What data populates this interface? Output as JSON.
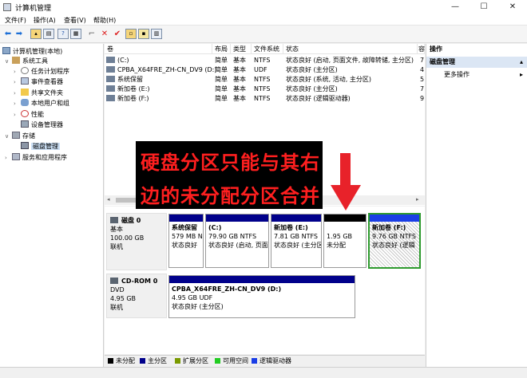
{
  "window": {
    "title": "计算机管理",
    "min": "—",
    "max": "☐",
    "close": "✕"
  },
  "menu": [
    "文件(F)",
    "操作(A)",
    "查看(V)",
    "帮助(H)"
  ],
  "toolbar_icons": [
    "back-icon",
    "forward-icon",
    "up-folder-icon",
    "show-tree-icon",
    "help-icon",
    "properties-icon",
    "connect-icon",
    "delete-icon",
    "check-icon",
    "open-icon",
    "new-window-icon",
    "refresh-icon"
  ],
  "tree": {
    "root": "计算机管理(本地)",
    "system_tools": "系统工具",
    "task_scheduler": "任务计划程序",
    "event_viewer": "事件查看器",
    "shared_folders": "共享文件夹",
    "local_users": "本地用户和组",
    "performance": "性能",
    "device_manager": "设备管理器",
    "storage": "存储",
    "disk_management": "磁盘管理",
    "services": "服务和应用程序"
  },
  "volume_table": {
    "headers": [
      "卷",
      "布局",
      "类型",
      "文件系统",
      "状态",
      "容"
    ],
    "rows": [
      {
        "vol": "(C:)",
        "layout": "简单",
        "type": "基本",
        "fs": "NTFS",
        "status": "状态良好 (启动, 页面文件, 故障转储, 主分区)",
        "cap": "7"
      },
      {
        "vol": "CPBA_X64FRE_ZH-CN_DV9 (D:)",
        "layout": "简单",
        "type": "基本",
        "fs": "UDF",
        "status": "状态良好 (主分区)",
        "cap": "4"
      },
      {
        "vol": "系统保留",
        "layout": "简单",
        "type": "基本",
        "fs": "NTFS",
        "status": "状态良好 (系统, 活动, 主分区)",
        "cap": "5"
      },
      {
        "vol": "新加卷 (E:)",
        "layout": "简单",
        "type": "基本",
        "fs": "NTFS",
        "status": "状态良好 (主分区)",
        "cap": "7"
      },
      {
        "vol": "新加卷 (F:)",
        "layout": "简单",
        "type": "基本",
        "fs": "NTFS",
        "status": "状态良好 (逻辑驱动器)",
        "cap": "9"
      }
    ]
  },
  "disk0": {
    "name": "磁盘 0",
    "kind": "基本",
    "size": "100.00 GB",
    "state": "联机",
    "parts": [
      {
        "title": "系统保留",
        "size": "579 MB N",
        "status": "状态良好"
      },
      {
        "title": "(C:)",
        "size": "79.90 GB NTFS",
        "status": "状态良好 (启动, 页面"
      },
      {
        "title": "新加卷 (E:)",
        "size": "7.81 GB NTFS",
        "status": "状态良好 (主分区)"
      },
      {
        "title": "",
        "size": "1.95 GB",
        "status": "未分配"
      },
      {
        "title": "新加卷 (F:)",
        "size": "9.76 GB NTFS",
        "status": "状态良好 (逻辑"
      }
    ]
  },
  "cdrom0": {
    "name": "CD-ROM 0",
    "kind": "DVD",
    "size": "4.95 GB",
    "state": "联机",
    "part": {
      "title": "CPBA_X64FRE_ZH-CN_DV9 (D:)",
      "size": "4.95 GB UDF",
      "status": "状态良好 (主分区)"
    }
  },
  "legend": [
    {
      "label": "未分配",
      "color": "#000000"
    },
    {
      "label": "主分区",
      "color": "#00008b"
    },
    {
      "label": "扩展分区",
      "color": "#7a9a00"
    },
    {
      "label": "可用空间",
      "color": "#22cc22"
    },
    {
      "label": "逻辑驱动器",
      "color": "#1a3ee6"
    }
  ],
  "actions": {
    "header": "操作",
    "section": "磁盘管理",
    "more": "更多操作"
  },
  "annotation": {
    "line1": "硬盘分区只能与其右",
    "line2": "边的未分配分区合并"
  },
  "colors": {
    "primary": "#00008b",
    "logical": "#1a3ee6",
    "unallocated": "#000000",
    "arrow": "#e8222a",
    "selected_border": "#2e9a2e",
    "annotation_text": "#ff1f1f"
  }
}
